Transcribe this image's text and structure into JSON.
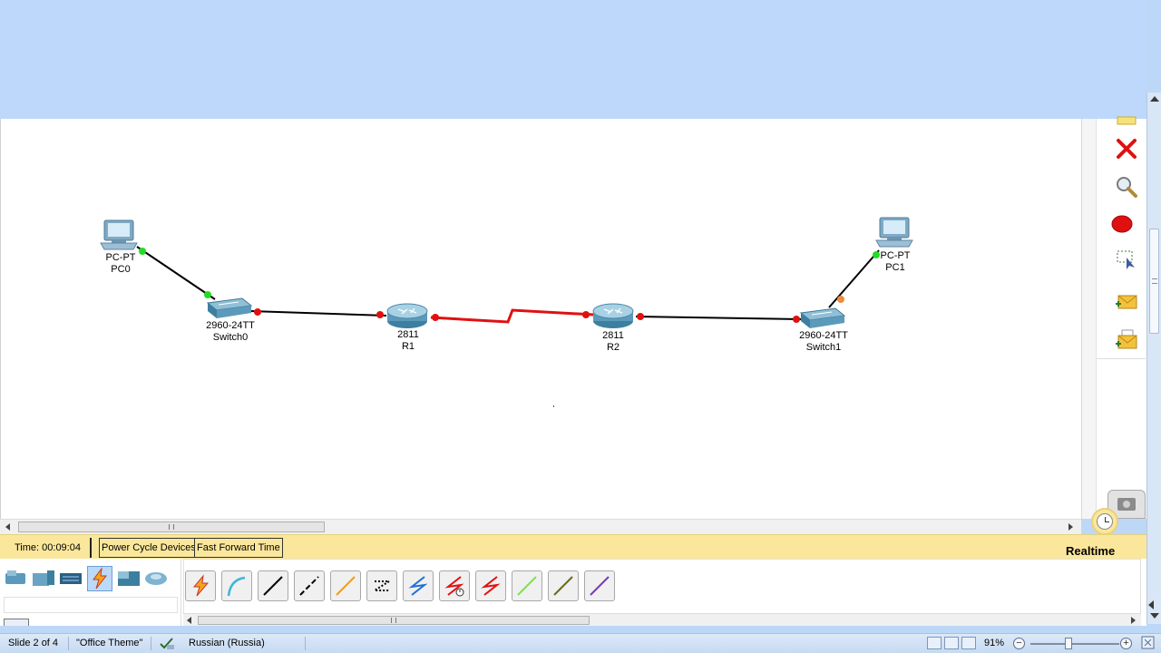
{
  "devices": [
    {
      "id": "pc0",
      "model": "PC-PT",
      "name": "PC0"
    },
    {
      "id": "switch0",
      "model": "2960-24TT",
      "name": "Switch0"
    },
    {
      "id": "r1",
      "model": "2811",
      "name": "R1"
    },
    {
      "id": "r2",
      "model": "2811",
      "name": "R2"
    },
    {
      "id": "switch1",
      "model": "2960-24TT",
      "name": "Switch1"
    },
    {
      "id": "pc1",
      "model": "PC-PT",
      "name": "PC1"
    }
  ],
  "links": [
    {
      "from": "pc0",
      "to": "switch0",
      "cable": "copper-straight",
      "status_from": "up",
      "status_to": "up"
    },
    {
      "from": "switch0",
      "to": "r1",
      "cable": "copper-straight",
      "status_from": "down",
      "status_to": "down"
    },
    {
      "from": "r1",
      "to": "r2",
      "cable": "serial-dce",
      "status_from": "down",
      "status_to": "down"
    },
    {
      "from": "r2",
      "to": "switch1",
      "cable": "copper-straight",
      "status_from": "down",
      "status_to": "down"
    },
    {
      "from": "switch1",
      "to": "pc1",
      "cable": "copper-straight",
      "status_from": "blocking",
      "status_to": "up"
    }
  ],
  "colors": {
    "link_up": "#22dd22",
    "link_down": "#e01010",
    "link_blocking": "#f08a3c",
    "serial_cable": "#e01010",
    "status_bar_bg": "#fbe79b",
    "delete_icon": "#e01010"
  },
  "right_toolbar": {
    "tools": [
      "note-icon",
      "delete-icon",
      "inspect-icon",
      "draw-shape-icon",
      "resize-icon",
      "add-simple-pdu-icon",
      "add-complex-pdu-icon"
    ]
  },
  "simulation_bar": {
    "time_text": "Time: 00:09:04",
    "power_cycle_label": "Power Cycle Devices",
    "fast_forward_label": "Fast Forward Time",
    "mode_label": "Realtime"
  },
  "device_categories": [
    "routers-icon",
    "switches-icon",
    "hubs-icon",
    "connections-icon",
    "end-devices-icon",
    "wan-emulation-icon"
  ],
  "selected_category": "connections-icon",
  "cables": [
    "automatic-cable-icon",
    "console-cable-icon",
    "copper-straight-through-icon",
    "copper-cross-over-icon",
    "fiber-icon",
    "phone-cable-icon",
    "coaxial-cable-icon",
    "serial-dce-icon",
    "serial-dte-icon",
    "octal-cable-icon",
    "iot-custom-cable-icon",
    "usb-cable-icon"
  ],
  "powerpoint_status": {
    "slide_info": "Slide 2 of 4",
    "theme": "\"Office Theme\"",
    "language": "Russian (Russia)",
    "zoom": "91%",
    "zoom_minus": "−",
    "zoom_plus": "+"
  }
}
